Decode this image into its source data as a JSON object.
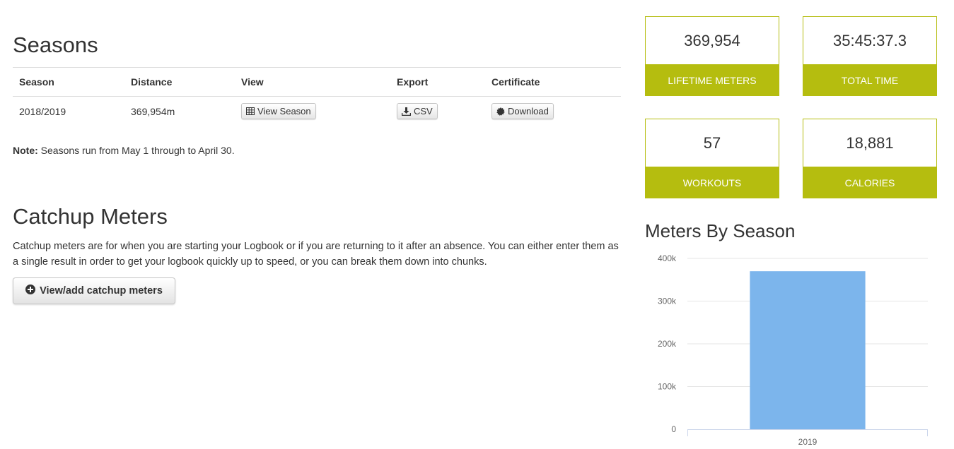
{
  "seasons": {
    "title": "Seasons",
    "columns": [
      "Season",
      "Distance",
      "View",
      "Export",
      "Certificate"
    ],
    "rows": [
      {
        "season": "2018/2019",
        "distance": "369,954m",
        "view_label": "View Season",
        "export_label": "CSV",
        "certificate_label": "Download"
      }
    ],
    "note_label": "Note:",
    "note_text": " Seasons run from May 1 through to April 30."
  },
  "catchup": {
    "title": "Catchup Meters",
    "description": "Catchup meters are for when you are starting your Logbook or if you are returning to it after an absence. You can either enter them as a single result in order to get your logbook quickly up to speed, or you can break them down into chunks.",
    "button_label": "View/add catchup meters"
  },
  "stats": [
    {
      "value": "369,954",
      "label": "Lifetime Meters"
    },
    {
      "value": "35:45:37.3",
      "label": "Total Time"
    },
    {
      "value": "57",
      "label": "Workouts"
    },
    {
      "value": "18,881",
      "label": "Calories"
    }
  ],
  "colors": {
    "accent": "#b5bd0f",
    "bar": "#7cb5ec",
    "text": "#333333"
  },
  "icons": {
    "view": "table-icon",
    "export": "download-icon",
    "certificate": "certificate-icon",
    "catchup": "plus-circle-icon"
  },
  "chart_data": {
    "type": "bar",
    "title": "Meters By Season",
    "categories": [
      "2019"
    ],
    "values": [
      369954
    ],
    "ylim": [
      0,
      400000
    ],
    "yticks": [
      0,
      100000,
      200000,
      300000,
      400000
    ],
    "ytick_labels": [
      "0",
      "100k",
      "200k",
      "300k",
      "400k"
    ],
    "grid": true,
    "legend": "none"
  }
}
